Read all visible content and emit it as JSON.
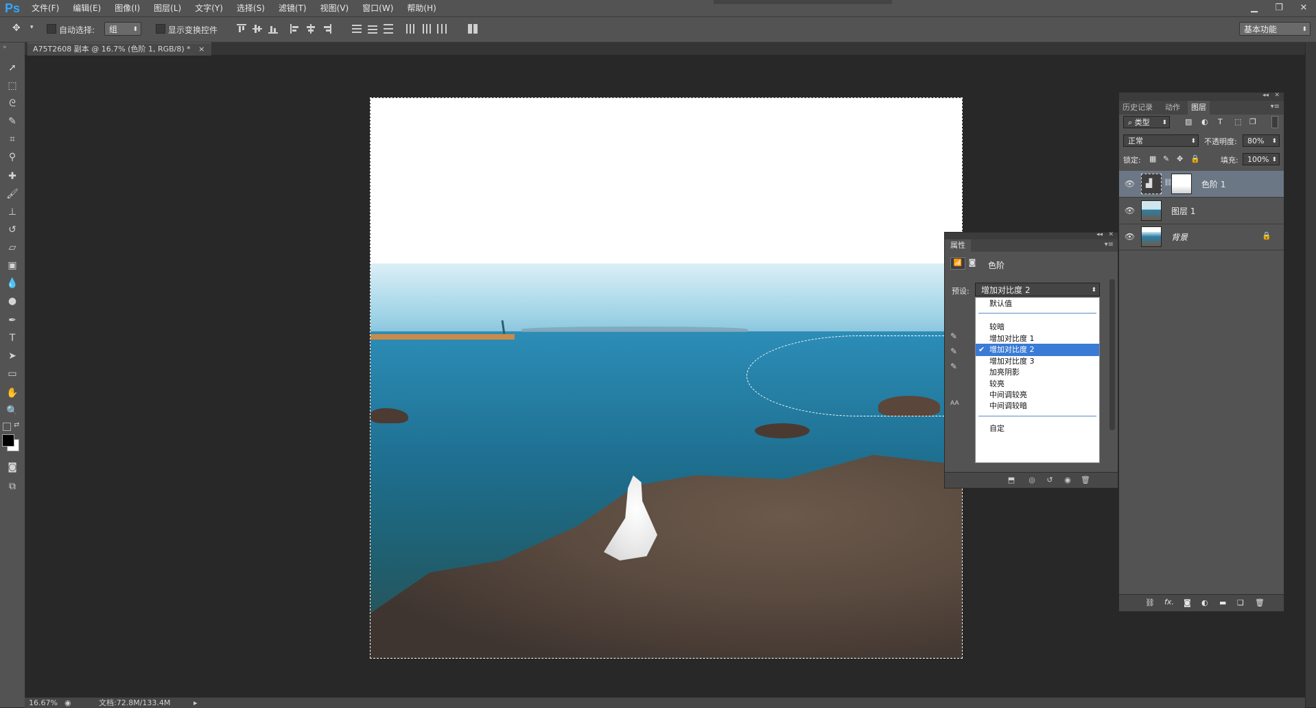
{
  "app": {
    "logo": "Ps"
  },
  "menu": [
    "文件(F)",
    "编辑(E)",
    "图像(I)",
    "图层(L)",
    "文字(Y)",
    "选择(S)",
    "滤镜(T)",
    "视图(V)",
    "窗口(W)",
    "帮助(H)"
  ],
  "window_controls": {
    "minimize": "▁",
    "restore": "❐",
    "close": "✕"
  },
  "options": {
    "auto_select_label": "自动选择:",
    "auto_select_value": "组",
    "show_transform_label": "显示变换控件",
    "workspace": "基本功能"
  },
  "document_tab": {
    "title": "A75T2608 副本 @ 16.7% (色阶 1, RGB/8) *",
    "close": "×"
  },
  "properties": {
    "tab": "属性",
    "title": "色阶",
    "preset_label": "预设:",
    "preset_value": "增加对比度 2",
    "dropdown": [
      {
        "label": "默认值",
        "selected": false
      },
      {
        "label": "较暗",
        "selected": false
      },
      {
        "label": "增加对比度 1",
        "selected": false
      },
      {
        "label": "增加对比度 2",
        "selected": true
      },
      {
        "label": "增加对比度 3",
        "selected": false
      },
      {
        "label": "加亮阴影",
        "selected": false
      },
      {
        "label": "较亮",
        "selected": false
      },
      {
        "label": "中间调较亮",
        "selected": false
      },
      {
        "label": "中间调较暗",
        "selected": false
      },
      {
        "label": "自定",
        "selected": false
      }
    ],
    "check_mark": "✔"
  },
  "layers_panel": {
    "tabs": [
      "历史记录",
      "动作",
      "图层"
    ],
    "active_tab": "图层",
    "filter_kind": "类型",
    "blend_mode": "正常",
    "opacity_label": "不透明度:",
    "opacity_value": "80%",
    "lock_label": "锁定:",
    "fill_label": "填充:",
    "fill_value": "100%",
    "layers": [
      {
        "name": "色阶 1",
        "active": true
      },
      {
        "name": "图层 1",
        "active": false
      },
      {
        "name": "背景",
        "active": false,
        "locked": true
      }
    ]
  },
  "status": {
    "zoom": "16.67%",
    "doc": "文档:72.8M/133.4M"
  },
  "colors": {
    "accent": "#3a7bd5",
    "ps_blue": "#31a8ff",
    "panel": "#535353"
  }
}
